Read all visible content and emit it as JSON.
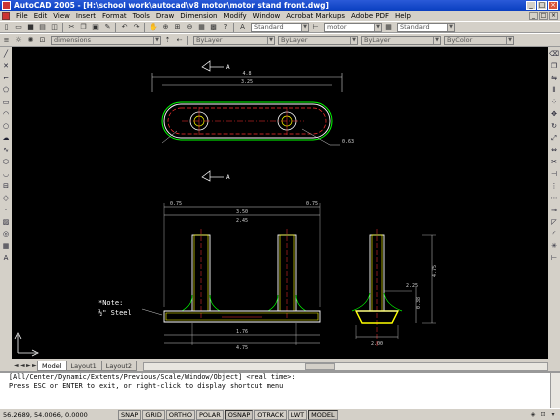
{
  "window": {
    "title": "AutoCAD 2005 - [H:\\school work\\autocad\\v8 motor\\motor stand front.dwg]",
    "controls": [
      "_",
      "□",
      "×"
    ]
  },
  "menubar": {
    "items": [
      "File",
      "Edit",
      "View",
      "Insert",
      "Format",
      "Tools",
      "Draw",
      "Dimension",
      "Modify",
      "Window",
      "Acrobat Markups",
      "Adobe PDF",
      "Help"
    ],
    "doc_controls": [
      "_",
      "□",
      "×"
    ]
  },
  "toolbars": {
    "text_style": "Standard",
    "dim_style": "motor",
    "table_style": "Standard",
    "layer": "dimensions",
    "color": "ByLayer",
    "linetype": "ByLayer",
    "lineweight": "ByLayer",
    "plot_style": "ByColor"
  },
  "drawing": {
    "note_text": [
      "*Note:",
      "½\" Steel"
    ],
    "section_marker": "A",
    "dims": {
      "plan_overall": "4.8",
      "plan_inner": "3.25",
      "plan_side": "0.63",
      "front_top_l": "0.75",
      "front_top_r": "0.75",
      "front_span": "3.50",
      "front_gap": "2.45",
      "front_base": "4.75",
      "front_sub": "1.76",
      "side_width": "2.00",
      "side_height": "4.75",
      "side_upper": "0.38",
      "side_r": "2.25"
    },
    "colors": {
      "background": "#000000",
      "outline": "#ffffff",
      "centerline": "#ff3030",
      "inner": "#ffff00",
      "accent": "#00ff00",
      "dimension": "#d0d0d0"
    }
  },
  "layout_tabs": {
    "nav_arrows": [
      "◄",
      "◄",
      "►",
      "►"
    ],
    "tabs": [
      "Model",
      "Layout1",
      "Layout2"
    ],
    "active": "Model"
  },
  "command_window": {
    "lines": [
      "[All/Center/Dynamic/Extents/Previous/Scale/Window/Object] <real time>:",
      "Press ESC or ENTER to exit, or right-click to display shortcut menu",
      ""
    ]
  },
  "statusbar": {
    "coordinates": "56.2689, 54.0066, 0.0000",
    "toggles": [
      {
        "label": "SNAP",
        "on": false
      },
      {
        "label": "GRID",
        "on": false
      },
      {
        "label": "ORTHO",
        "on": false
      },
      {
        "label": "POLAR",
        "on": false
      },
      {
        "label": "OSNAP",
        "on": true
      },
      {
        "label": "OTRACK",
        "on": false
      },
      {
        "label": "LWT",
        "on": false
      },
      {
        "label": "MODEL",
        "on": true
      }
    ]
  }
}
